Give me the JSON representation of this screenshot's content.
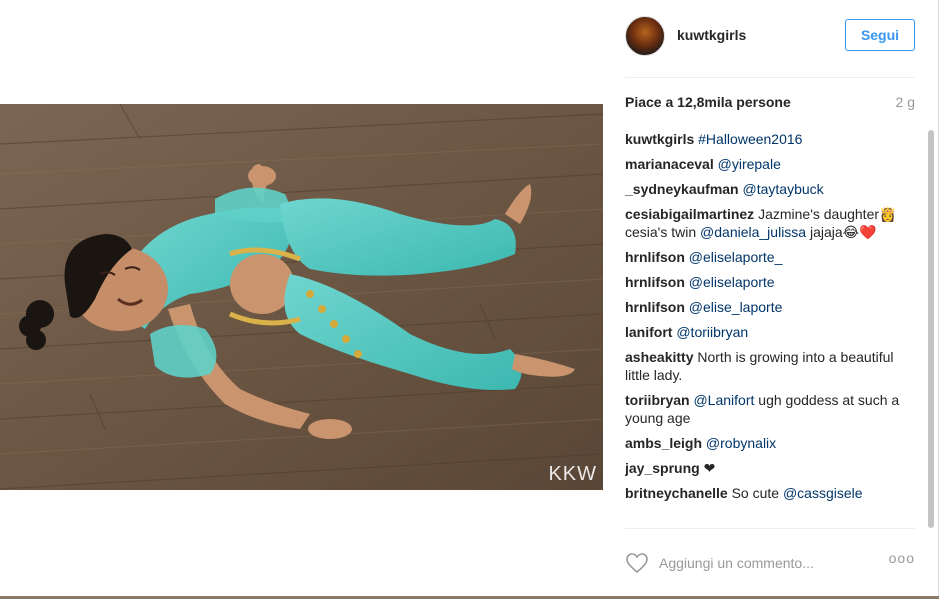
{
  "post": {
    "username": "kuwtkgirls",
    "follow_label": "Segui",
    "likes": "Piace a 12,8mila persone",
    "time_ago": "2 g",
    "watermark": "KKW"
  },
  "comments": [
    {
      "user": "kuwtkgirls",
      "segments": [
        {
          "type": "link",
          "text": "#Halloween2016"
        }
      ]
    },
    {
      "user": "marianaceval",
      "segments": [
        {
          "type": "link",
          "text": "@yirepale"
        }
      ]
    },
    {
      "user": "_sydneykaufman",
      "segments": [
        {
          "type": "link",
          "text": "@taytaybuck"
        }
      ]
    },
    {
      "user": "cesiabigailmartinez",
      "segments": [
        {
          "type": "text",
          "text": "Jazmine's daughter👸 cesia's twin "
        },
        {
          "type": "link",
          "text": "@daniela_julissa"
        },
        {
          "type": "text",
          "text": " jajaja😂❤️"
        }
      ]
    },
    {
      "user": "hrnlifson",
      "segments": [
        {
          "type": "link",
          "text": "@eliselaporte_"
        }
      ]
    },
    {
      "user": "hrnlifson",
      "segments": [
        {
          "type": "link",
          "text": "@eliselaporte"
        }
      ]
    },
    {
      "user": "hrnlifson",
      "segments": [
        {
          "type": "link",
          "text": "@elise_laporte"
        }
      ]
    },
    {
      "user": "lanifort",
      "segments": [
        {
          "type": "link",
          "text": "@toriibryan"
        }
      ]
    },
    {
      "user": "asheakitty",
      "segments": [
        {
          "type": "text",
          "text": "North is growing into a beautiful little lady."
        }
      ]
    },
    {
      "user": "toriibryan",
      "segments": [
        {
          "type": "link",
          "text": "@Lanifort"
        },
        {
          "type": "text",
          "text": " ugh goddess at such a young age"
        }
      ]
    },
    {
      "user": "ambs_leigh",
      "segments": [
        {
          "type": "link",
          "text": "@robynalix"
        }
      ]
    },
    {
      "user": "jay_sprung",
      "segments": [
        {
          "type": "text",
          "text": "❤"
        }
      ]
    },
    {
      "user": "britneychanelle",
      "segments": [
        {
          "type": "text",
          "text": "So cute "
        },
        {
          "type": "link",
          "text": "@cassgisele"
        }
      ]
    }
  ],
  "comment_box": {
    "placeholder": "Aggiungi un commento...",
    "more_label": "ooo"
  },
  "icons": {
    "like": "heart-outline-icon",
    "options": "more-options-icon"
  },
  "colors": {
    "accent": "#3897f0",
    "link": "#003569",
    "muted": "#999999",
    "text": "#262626"
  }
}
